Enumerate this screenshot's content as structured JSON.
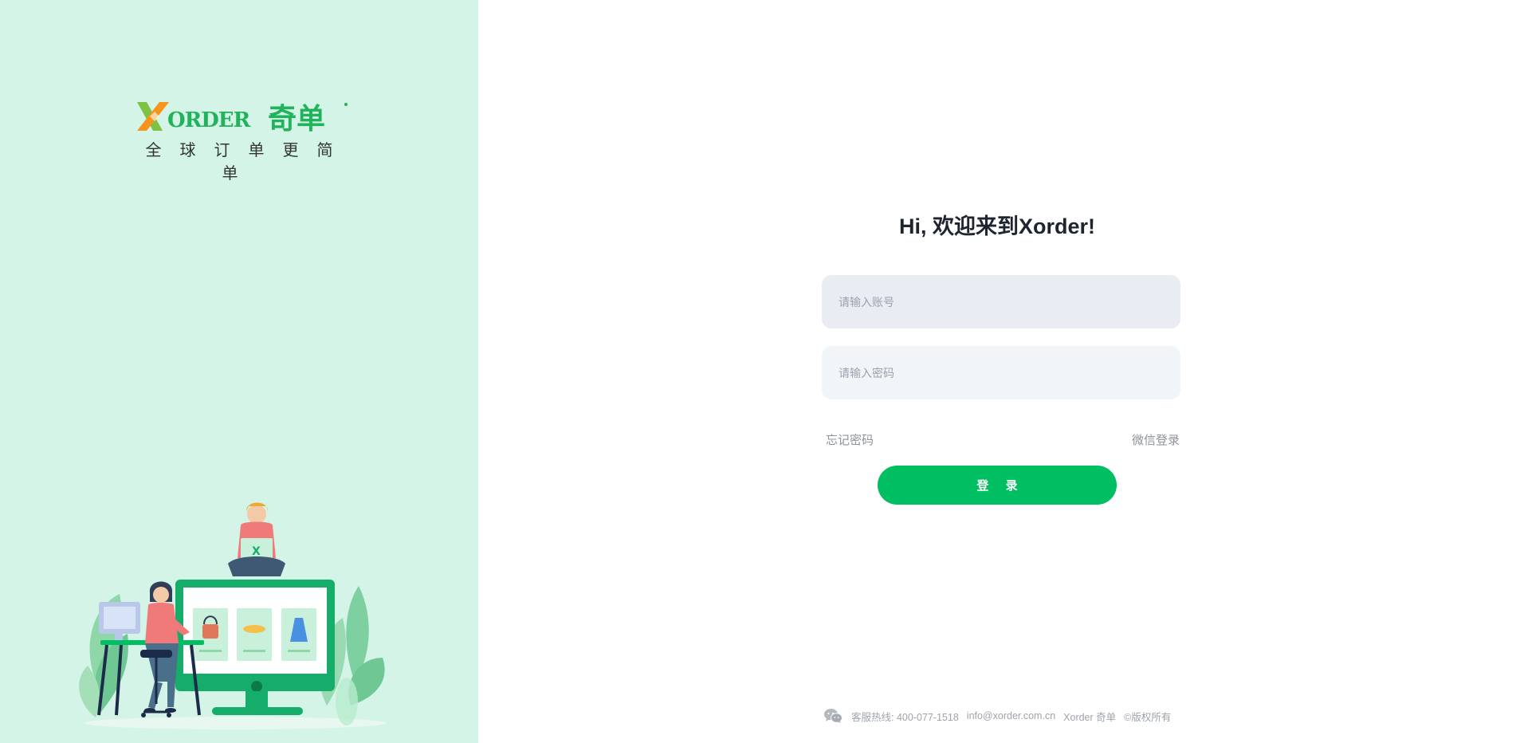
{
  "brand": {
    "logo_text": "XORDER",
    "logo_cn": "奇单",
    "slogan": "全球订单更简单",
    "colors": {
      "green": "#00bf63",
      "orange": "#f7941d",
      "panel_bg": "#d3f4e6"
    }
  },
  "login": {
    "greeting": "Hi, 欢迎来到Xorder!",
    "account_placeholder": "请输入账号",
    "password_placeholder": "请输入密码",
    "forgot_password": "忘记密码",
    "wechat_login": "微信登录",
    "login_button": "登 录"
  },
  "footer": {
    "icon": "wechat-icon",
    "hotline": "客服热线: 400-077-1518",
    "email": "info@xorder.com.cn",
    "company": "Xorder 奇单",
    "copyright": "©版权所有"
  }
}
